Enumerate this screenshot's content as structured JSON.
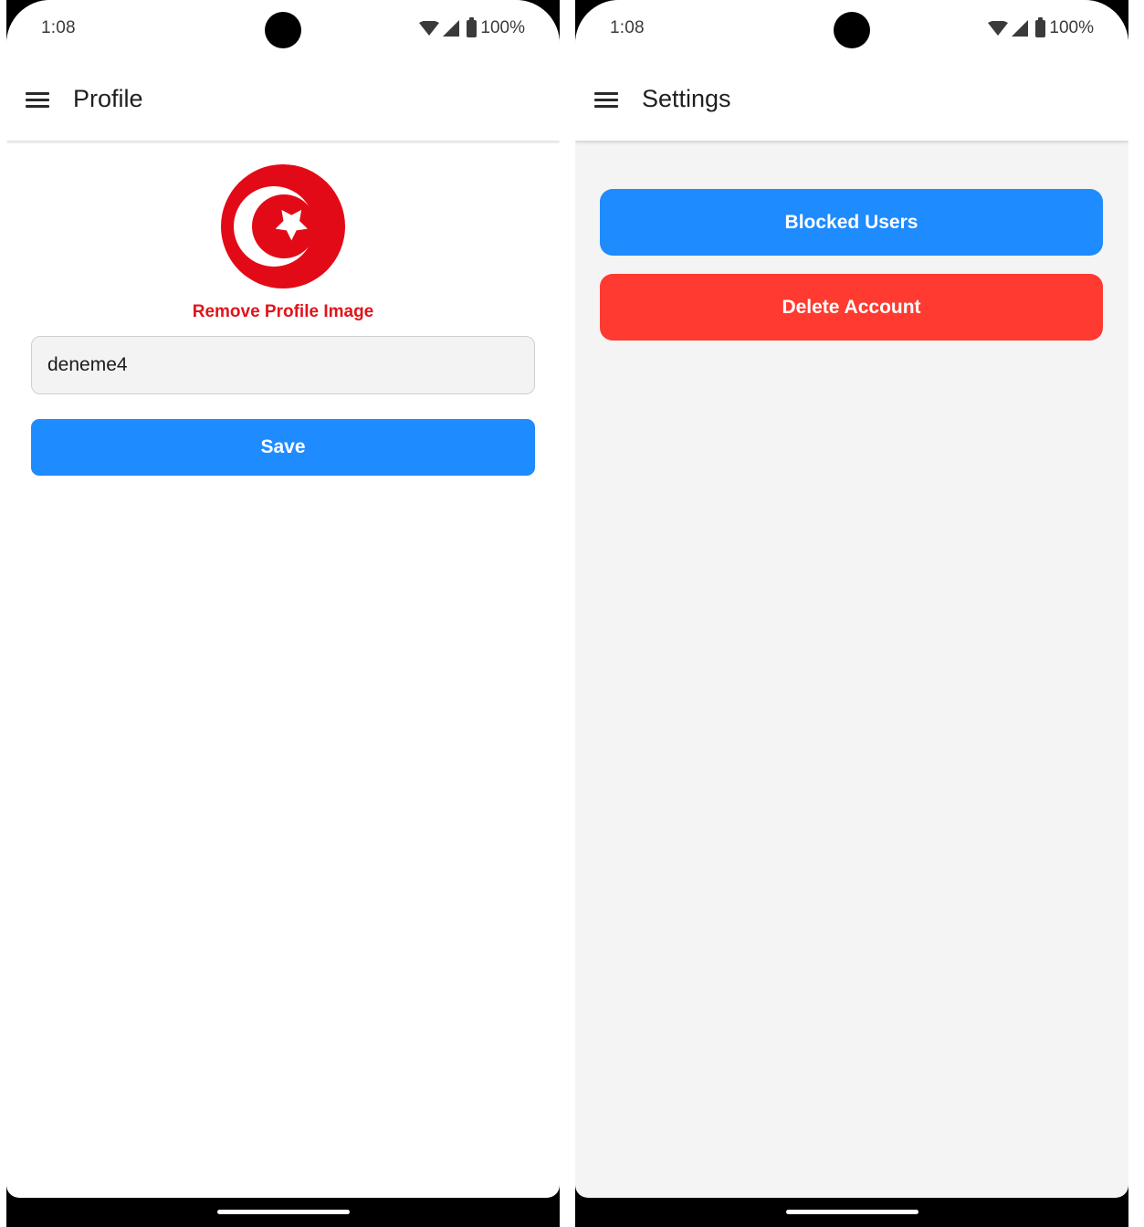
{
  "status_bar": {
    "time": "1:08",
    "battery": "100%"
  },
  "profile_screen": {
    "title": "Profile",
    "avatar_icon": "turkey-flag-avatar",
    "remove_image_label": "Remove Profile Image",
    "username_value": "deneme4",
    "save_label": "Save"
  },
  "settings_screen": {
    "title": "Settings",
    "blocked_users_label": "Blocked Users",
    "delete_account_label": "Delete Account"
  },
  "colors": {
    "primary_blue": "#1e8bff",
    "danger_red": "#ff3a30",
    "link_red": "#e0151b",
    "flag_red": "#e30a17"
  }
}
